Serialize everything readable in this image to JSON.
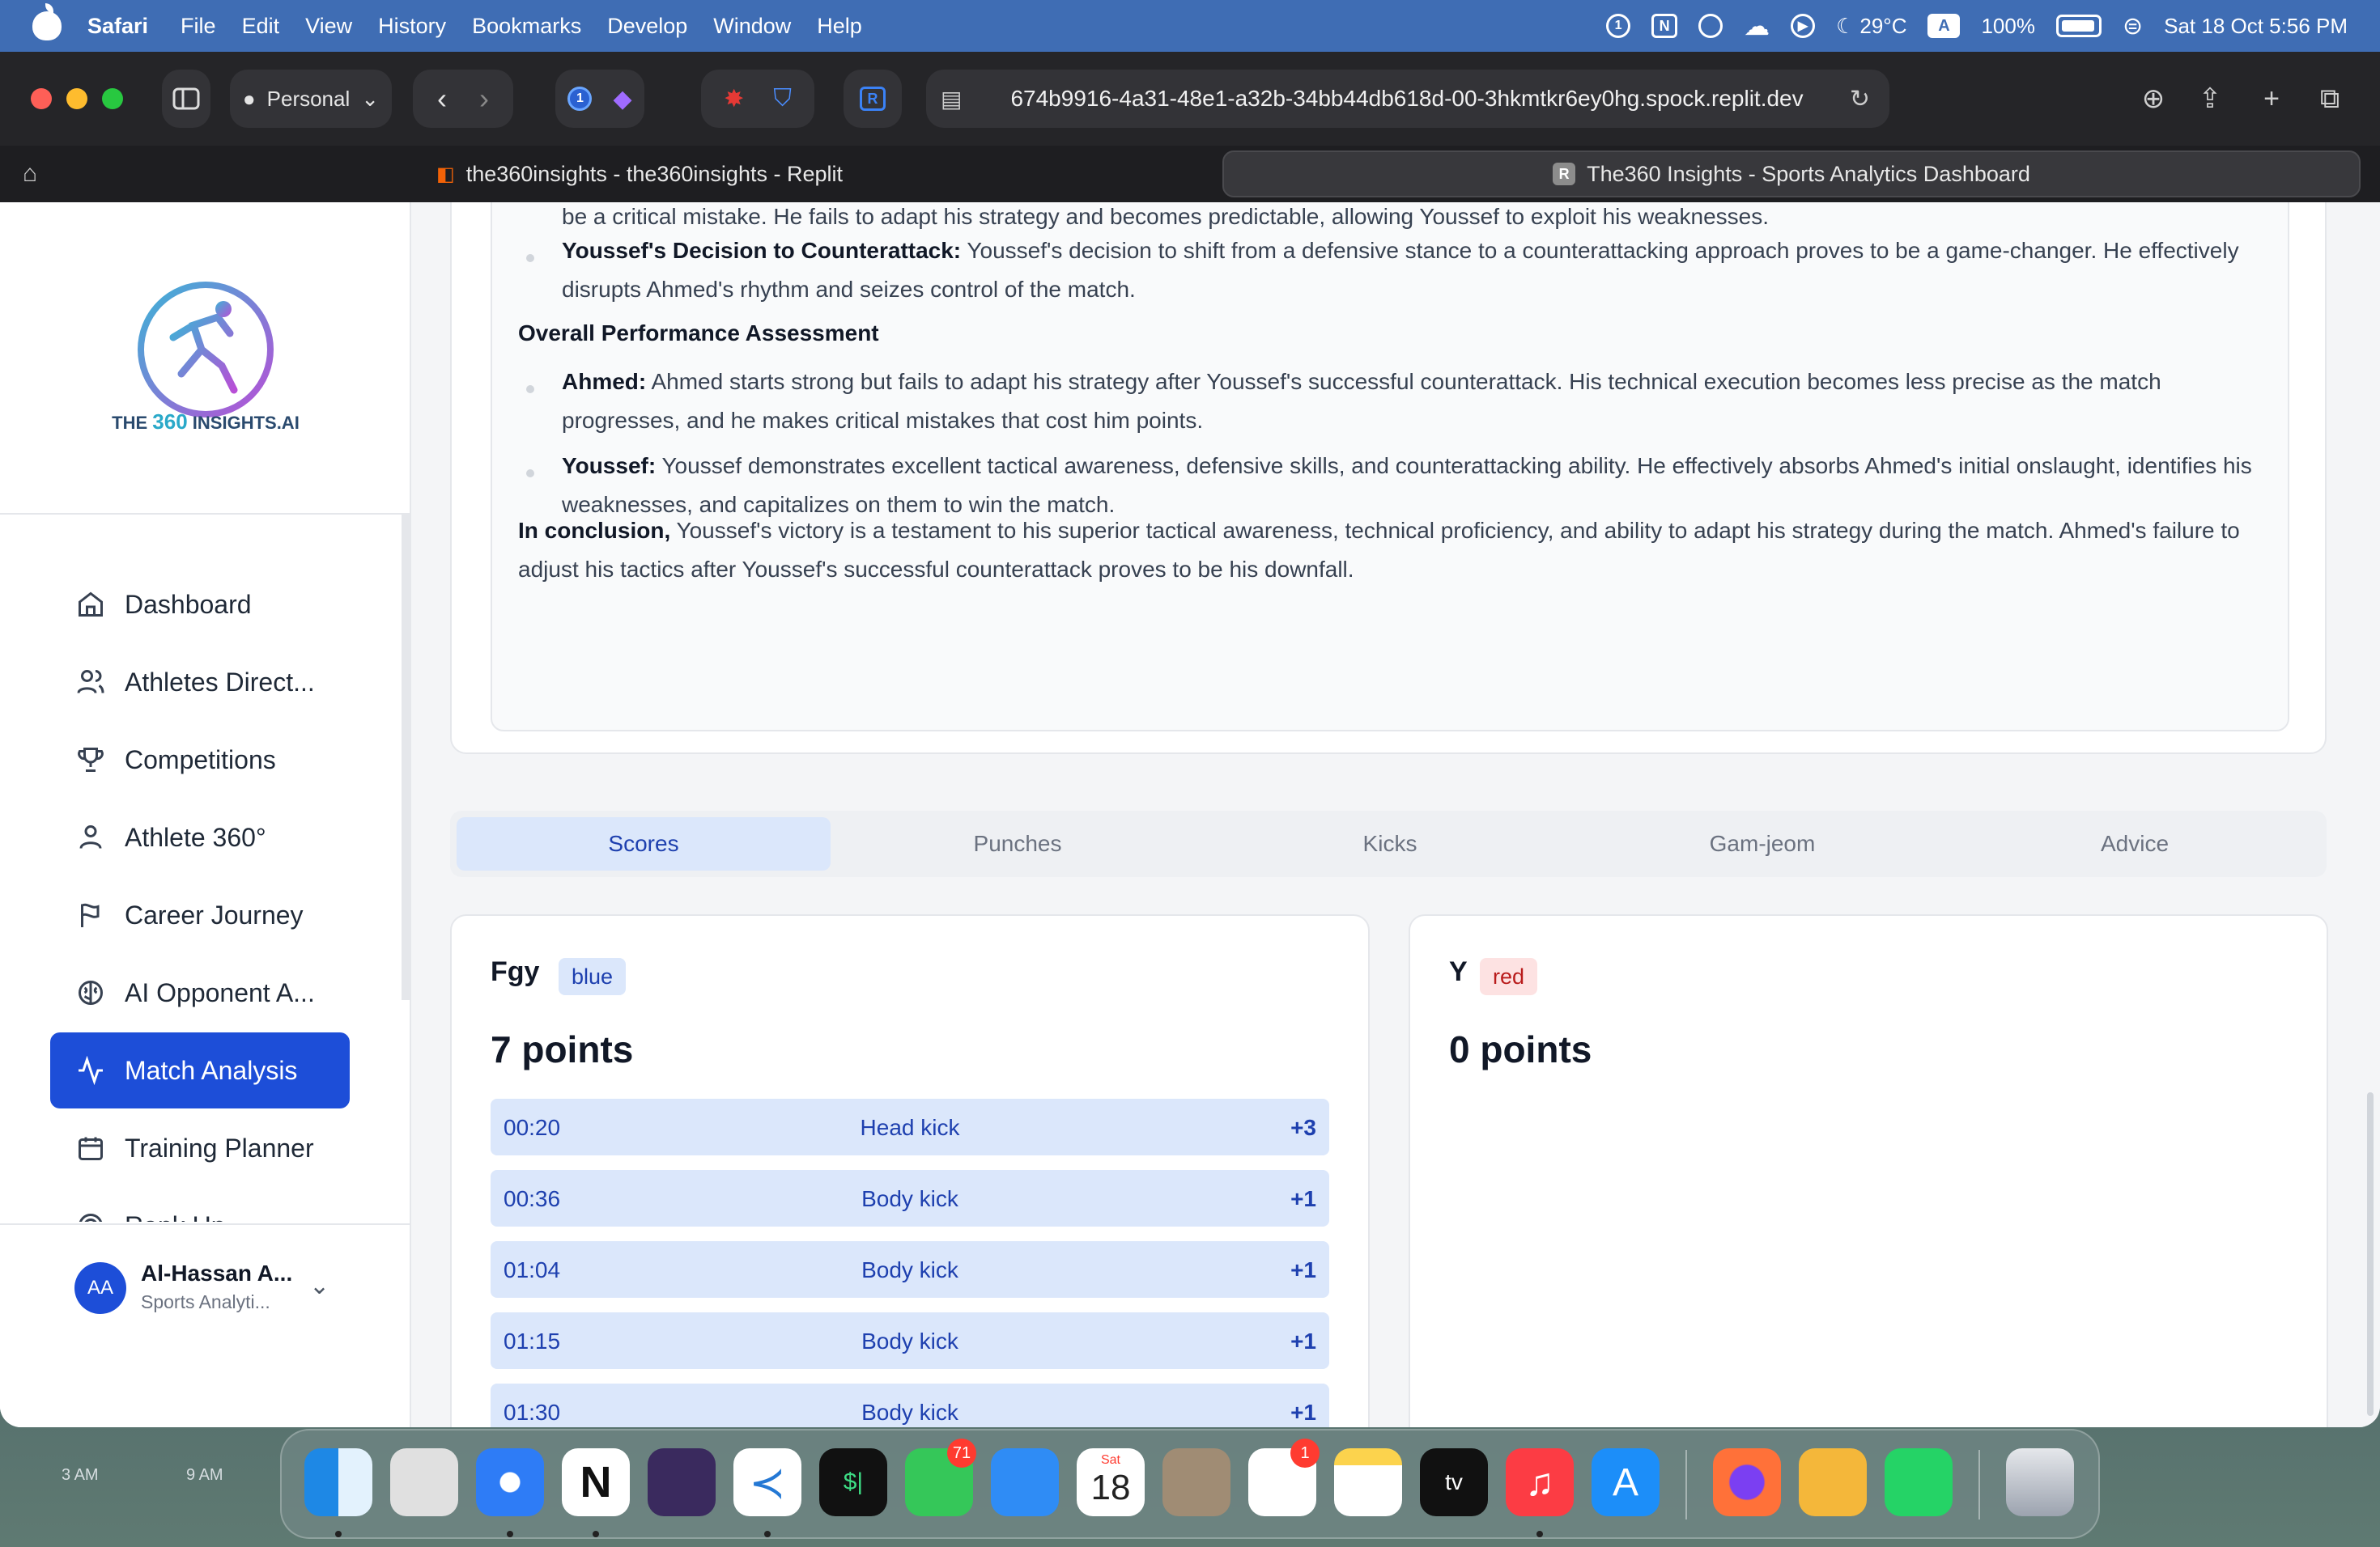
{
  "menubar": {
    "app_name": "Safari",
    "items": [
      "File",
      "Edit",
      "View",
      "History",
      "Bookmarks",
      "Develop",
      "Window",
      "Help"
    ],
    "weather": "29°C",
    "input_source": "A",
    "battery": "100%",
    "datetime": "Sat 18 Oct  5:56 PM"
  },
  "browser": {
    "profile": "Personal",
    "url": "674b9916-4a31-48e1-a32b-34bb44db618d-00-3hkmtkr6ey0hg.spock.replit.dev",
    "tabs": [
      {
        "title": "the360insights - the360insights - Replit"
      },
      {
        "title": "The360 Insights - Sports Analytics Dashboard"
      }
    ]
  },
  "sidebar": {
    "logo_text_prefix": "THE ",
    "logo_text_accent": "360",
    "logo_text_suffix": " INSIGHTS.AI",
    "items": [
      {
        "label": "Dashboard",
        "icon": "home-icon"
      },
      {
        "label": "Athletes Direct...",
        "icon": "users-icon"
      },
      {
        "label": "Competitions",
        "icon": "trophy-icon"
      },
      {
        "label": "Athlete 360°",
        "icon": "user-icon"
      },
      {
        "label": "Career Journey",
        "icon": "flag-icon"
      },
      {
        "label": "AI Opponent A...",
        "icon": "brain-icon"
      },
      {
        "label": "Match Analysis",
        "icon": "activity-icon"
      },
      {
        "label": "Training Planner",
        "icon": "calendar-icon"
      },
      {
        "label": "Rank Up",
        "icon": "target-icon"
      }
    ],
    "active_item": "Match Analysis",
    "user": {
      "initials": "AA",
      "name": "Al-Hassan A...",
      "role": "Sports Analyti..."
    }
  },
  "analysis": {
    "top_fragment": "be a critical mistake. He fails to adapt his strategy and becomes predictable, allowing Youssef to exploit his weaknesses.",
    "decision_title": "Youssef's Decision to Counterattack:",
    "decision_text": " Youssef's decision to shift from a defensive stance to a counterattacking approach proves to be a game-changer. He effectively disrupts Ahmed's rhythm and seizes control of the match.",
    "overall_heading": "Overall Performance Assessment",
    "ahmed_label": "Ahmed:",
    "ahmed_text": " Ahmed starts strong but fails to adapt his strategy after Youssef's successful counterattack. His technical execution becomes less precise as the match progresses, and he makes critical mistakes that cost him points.",
    "youssef_label": "Youssef:",
    "youssef_text": " Youssef demonstrates excellent tactical awareness, defensive skills, and counterattacking ability. He effectively absorbs Ahmed's initial onslaught, identifies his weaknesses, and capitalizes on them to win the match.",
    "conclusion_label": "In conclusion,",
    "conclusion_text": " Youssef's victory is a testament to his superior tactical awareness, technical proficiency, and ability to adapt his strategy during the match. Ahmed's failure to adjust his tactics after Youssef's successful counterattack proves to be his downfall."
  },
  "tabs": {
    "items": [
      "Scores",
      "Punches",
      "Kicks",
      "Gam-jeom",
      "Advice"
    ],
    "active": "Scores"
  },
  "players": {
    "blue": {
      "name": "Fgy",
      "corner": "blue",
      "points": "7 points",
      "scores": [
        {
          "time": "00:20",
          "action": "Head kick",
          "value": "+3"
        },
        {
          "time": "00:36",
          "action": "Body kick",
          "value": "+1"
        },
        {
          "time": "01:04",
          "action": "Body kick",
          "value": "+1"
        },
        {
          "time": "01:15",
          "action": "Body kick",
          "value": "+1"
        },
        {
          "time": "01:30",
          "action": "Body kick",
          "value": "+1"
        }
      ]
    },
    "red": {
      "name": "Y",
      "corner": "red",
      "points": "0 points"
    }
  },
  "desktop": {
    "widget_labels": [
      "3 AM",
      "9 AM"
    ],
    "dock_badges": {
      "messages": "71",
      "reminders": "1"
    },
    "calendar_day": "Sat",
    "calendar_date": "18"
  },
  "colors": {
    "accent": "#1d4ed8",
    "blue_badge_bg": "#dbe7fb",
    "red_badge_bg": "#fde2e2",
    "red_badge_text": "#b91c1c"
  }
}
